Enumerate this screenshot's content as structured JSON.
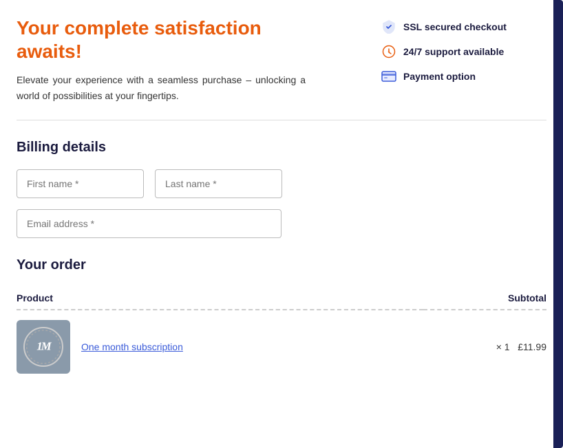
{
  "hero": {
    "title": "Your complete satisfaction awaits!",
    "subtitle": "Elevate your experience with a seamless purchase – unlocking a world of possibilities at your fingertips."
  },
  "features": [
    {
      "id": "ssl",
      "label": "SSL secured checkout",
      "icon": "🛡"
    },
    {
      "id": "support",
      "label": "24/7 support available",
      "icon": "⊗"
    },
    {
      "id": "payment",
      "label": "Payment option",
      "icon": "💳"
    }
  ],
  "billing": {
    "title": "Billing details",
    "fields": {
      "first_name_placeholder": "First name *",
      "last_name_placeholder": "Last name *",
      "email_placeholder": "Email address *"
    }
  },
  "order": {
    "title": "Your order",
    "columns": {
      "product": "Product",
      "subtotal": "Subtotal"
    },
    "items": [
      {
        "name": "One month subscription",
        "quantity": "× 1",
        "price": "£11.99",
        "thumbnail_text": "1M"
      }
    ]
  }
}
